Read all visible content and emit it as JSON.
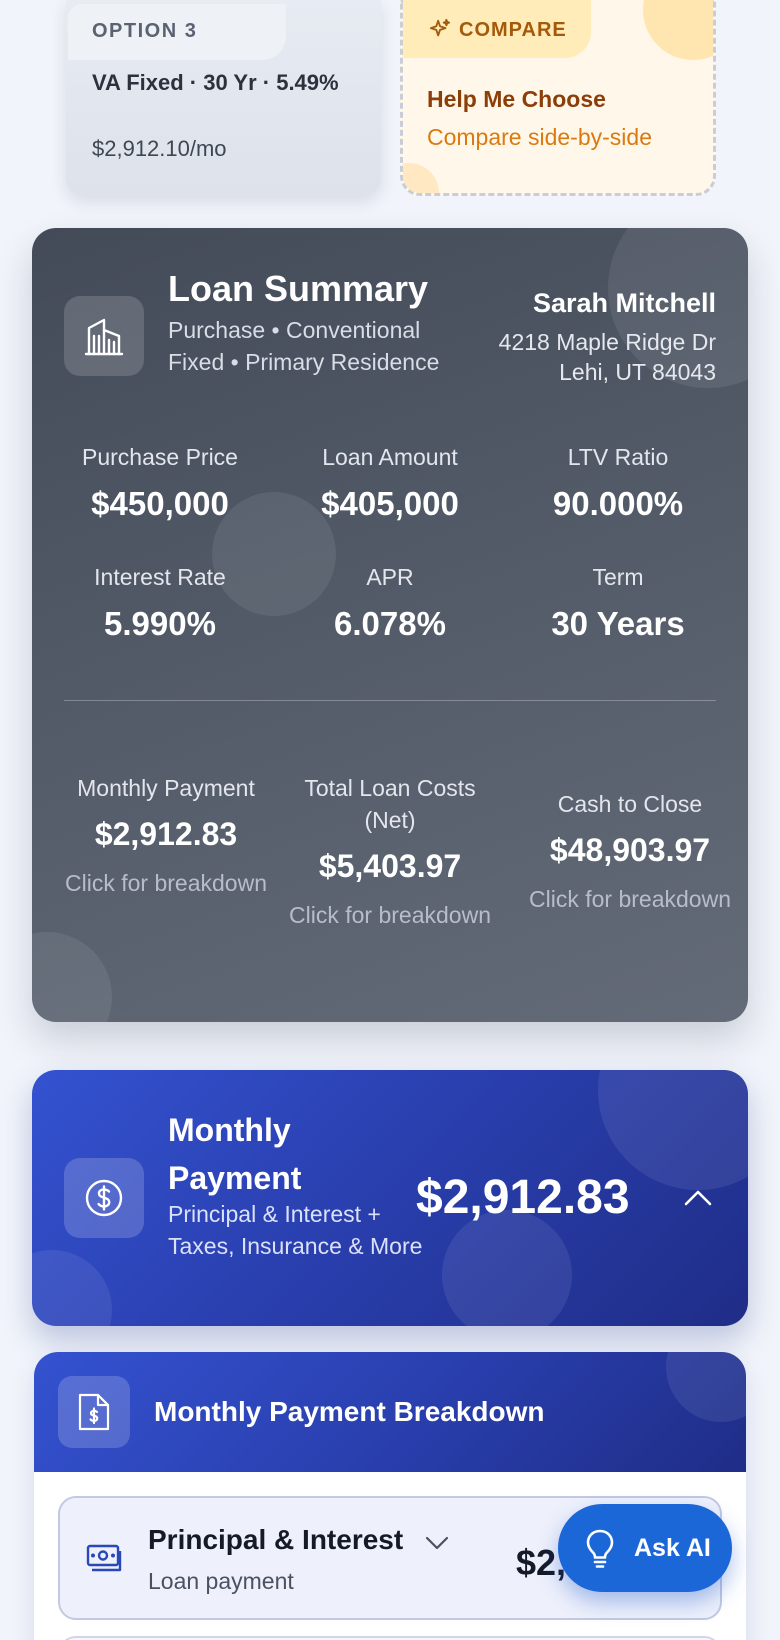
{
  "option_card": {
    "tag": "OPTION 3",
    "title": "VA Fixed · 30 Yr · 5.49%",
    "price": "$2,912.10/mo"
  },
  "compare_card": {
    "tag": "COMPARE",
    "title": "Help Me Choose",
    "subtitle": "Compare side-by-side"
  },
  "loan_summary": {
    "title": "Loan Summary",
    "subtitle": "Purchase • Conventional Fixed • Primary Residence",
    "borrower_name": "Sarah Mitchell",
    "address_line1": "4218 Maple Ridge Dr",
    "address_line2": "Lehi, UT 84043",
    "metrics": [
      {
        "label": "Purchase Price",
        "value": "$450,000"
      },
      {
        "label": "Loan Amount",
        "value": "$405,000"
      },
      {
        "label": "LTV Ratio",
        "value": "90.000%"
      },
      {
        "label": "Interest Rate",
        "value": "5.990%"
      },
      {
        "label": "APR",
        "value": "6.078%"
      },
      {
        "label": "Term",
        "value": "30 Years"
      }
    ],
    "totals": [
      {
        "label": "Monthly Payment",
        "value": "$2,912.83",
        "link": "Click for breakdown"
      },
      {
        "label": "Total Loan Costs (Net)",
        "value": "$5,403.97",
        "link": "Click for breakdown"
      },
      {
        "label": "Cash to Close",
        "value": "$48,903.97",
        "link": "Click for breakdown"
      }
    ]
  },
  "monthly_payment": {
    "title": "Monthly Payment",
    "subtitle": "Principal & Interest + Taxes, Insurance & More",
    "amount": "$2,912.83"
  },
  "breakdown": {
    "title": "Monthly Payment Breakdown",
    "row_title": "Principal & Interest",
    "row_subtitle": "Loan payment",
    "row_amount": "$2,"
  },
  "ask_ai": {
    "label": "Ask AI"
  },
  "colors": {
    "summary_bg": "#4a5160",
    "payment_blue": "#2a40b0",
    "ask_ai_blue": "#1c67d8",
    "compare_accent": "#da7a0f"
  }
}
